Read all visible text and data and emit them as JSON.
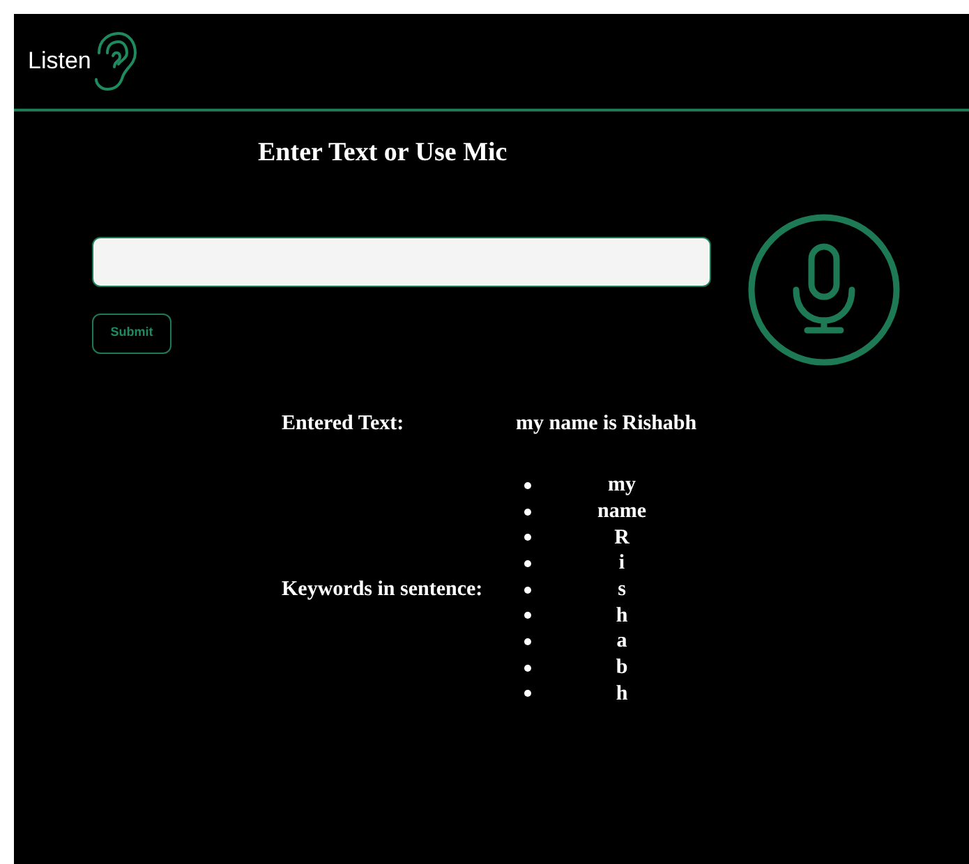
{
  "header": {
    "brand": "Listen"
  },
  "title": "Enter Text or Use Mic",
  "submit_button": "Submit",
  "entered_text": {
    "label": "Entered Text:",
    "value": "my name is Rishabh"
  },
  "keywords": {
    "label": "Keywords in sentence:",
    "items": [
      "my",
      "name",
      "R",
      "i",
      "s",
      "h",
      "a",
      "b",
      "h"
    ]
  }
}
